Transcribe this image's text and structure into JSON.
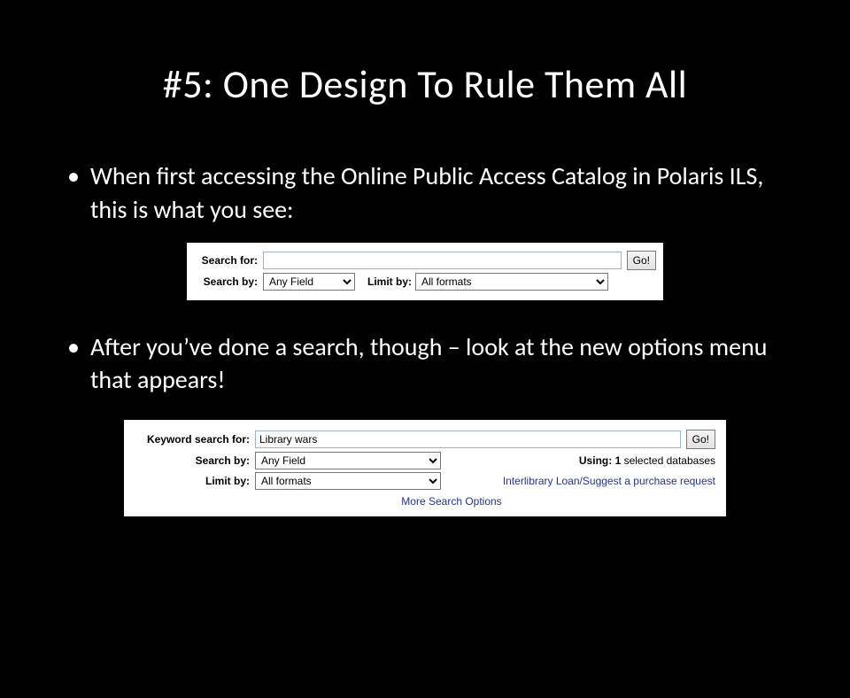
{
  "title": "#5: One Design To Rule Them All",
  "bullets": {
    "b1": "When first accessing the Online Public Access Catalog in Polaris ILS, this is what you see:",
    "b2": "After you’ve done a search, though – look at the new options menu that appears!"
  },
  "shot1": {
    "labels": {
      "search_for": "Search for:",
      "search_by": "Search by:",
      "limit_by": "Limit by:"
    },
    "search_value": "",
    "search_by_value": "Any Field",
    "limit_by_value": "All formats",
    "go_label": "Go!"
  },
  "shot2": {
    "labels": {
      "keyword_search_for": "Keyword search for:",
      "search_by": "Search by:",
      "limit_by": "Limit by:",
      "using_prefix": "Using: ",
      "using_count": "1",
      "using_suffix": " selected databases"
    },
    "search_value": "Library wars",
    "search_by_value": "Any Field",
    "limit_by_value": "All formats",
    "go_label": "Go!",
    "ill_link": "Interlibrary Loan/Suggest a purchase request",
    "more_options": "More Search Options"
  }
}
